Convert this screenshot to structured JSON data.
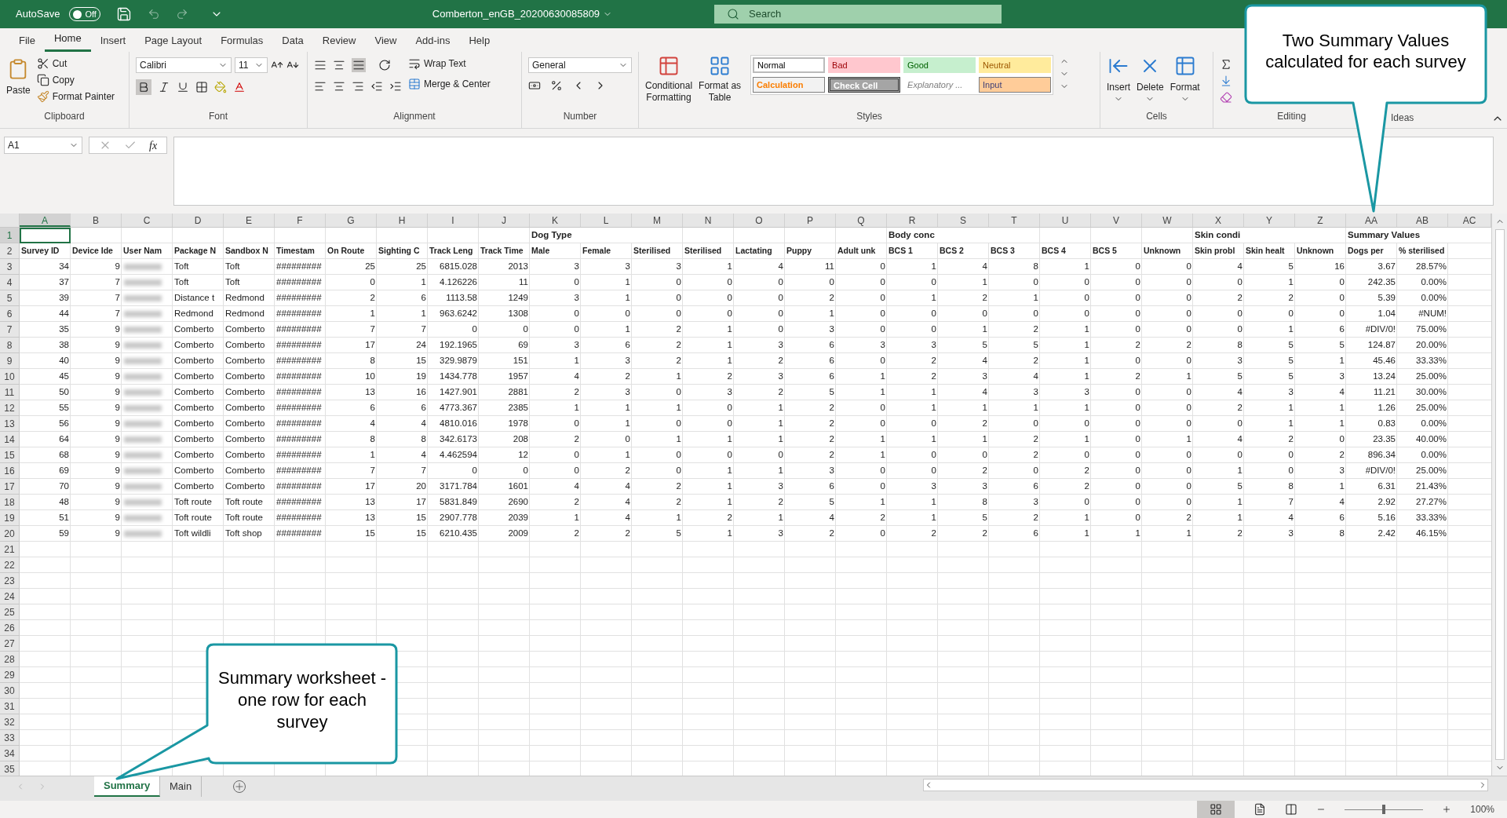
{
  "title_bar": {
    "autosave_label": "AutoSave",
    "autosave_on": false,
    "autosave_state": "Off",
    "filename": "Comberton_enGB_20200630085809",
    "search_placeholder": "Search"
  },
  "menu_tabs": [
    {
      "label": "File",
      "selected": false
    },
    {
      "label": "Home",
      "selected": true
    },
    {
      "label": "Insert",
      "selected": false
    },
    {
      "label": "Page Layout",
      "selected": false
    },
    {
      "label": "Formulas",
      "selected": false
    },
    {
      "label": "Data",
      "selected": false
    },
    {
      "label": "Review",
      "selected": false
    },
    {
      "label": "View",
      "selected": false
    },
    {
      "label": "Add-ins",
      "selected": false
    },
    {
      "label": "Help",
      "selected": false
    }
  ],
  "ribbon": {
    "clipboard": {
      "label": "Clipboard",
      "paste": "Paste",
      "cut": "Cut",
      "copy": "Copy",
      "format_painter": "Format Painter"
    },
    "font": {
      "label": "Font",
      "font_name": "Calibri",
      "font_size": "11"
    },
    "alignment": {
      "label": "Alignment",
      "wrap_text": "Wrap Text",
      "merge_center": "Merge & Center"
    },
    "number": {
      "label": "Number",
      "format": "General"
    },
    "styles": {
      "label": "Styles",
      "conditional_formatting": [
        "Conditional",
        "Formatting"
      ],
      "format_as_table": [
        "Format as",
        "Table"
      ],
      "gallery": [
        {
          "label": "Normal",
          "kind": "normal"
        },
        {
          "label": "Bad",
          "kind": "bad"
        },
        {
          "label": "Good",
          "kind": "good"
        },
        {
          "label": "Neutral",
          "kind": "neutral"
        },
        {
          "label": "Calculation",
          "kind": "calculation"
        },
        {
          "label": "Check Cell",
          "kind": "check"
        },
        {
          "label": "Explanatory ...",
          "kind": "explanatory"
        },
        {
          "label": "Input",
          "kind": "input"
        }
      ]
    },
    "cells": {
      "label": "Cells",
      "buttons": [
        "Insert",
        "Delete",
        "Format"
      ]
    },
    "editing": {
      "label": "Editing"
    },
    "ideas": {
      "label": "Ideas"
    }
  },
  "formula_bar": {
    "name_box": "A1",
    "function_label": "fx"
  },
  "columns": [
    {
      "letter": "A",
      "kind": "number"
    },
    {
      "letter": "B",
      "kind": "number"
    },
    {
      "letter": "C",
      "kind": "text"
    },
    {
      "letter": "D",
      "kind": "text"
    },
    {
      "letter": "E",
      "kind": "text"
    },
    {
      "letter": "F",
      "kind": "text"
    },
    {
      "letter": "G",
      "kind": "number"
    },
    {
      "letter": "H",
      "kind": "number"
    },
    {
      "letter": "I",
      "kind": "number"
    },
    {
      "letter": "J",
      "kind": "number"
    },
    {
      "letter": "K",
      "kind": "number"
    },
    {
      "letter": "L",
      "kind": "number"
    },
    {
      "letter": "M",
      "kind": "number"
    },
    {
      "letter": "N",
      "kind": "number"
    },
    {
      "letter": "O",
      "kind": "number"
    },
    {
      "letter": "P",
      "kind": "number"
    },
    {
      "letter": "Q",
      "kind": "number"
    },
    {
      "letter": "R",
      "kind": "number"
    },
    {
      "letter": "S",
      "kind": "number"
    },
    {
      "letter": "T",
      "kind": "number"
    },
    {
      "letter": "U",
      "kind": "number"
    },
    {
      "letter": "V",
      "kind": "number"
    },
    {
      "letter": "W",
      "kind": "number"
    },
    {
      "letter": "X",
      "kind": "number"
    },
    {
      "letter": "Y",
      "kind": "number"
    },
    {
      "letter": "Z",
      "kind": "number"
    },
    {
      "letter": "AA",
      "kind": "number"
    },
    {
      "letter": "AB",
      "kind": "number"
    },
    {
      "letter": "AC",
      "kind": "number"
    }
  ],
  "rows": [
    {
      "number": "1",
      "redacted": false,
      "header": true,
      "cells": [
        {
          "selected": true
        },
        null,
        null,
        null,
        null,
        null,
        null,
        null,
        null,
        null,
        "Dog Type",
        null,
        null,
        null,
        null,
        null,
        null,
        "Body conc",
        null,
        null,
        null,
        null,
        null,
        "Skin condi",
        null,
        null,
        "Summary Values",
        null,
        null
      ]
    },
    {
      "number": "2",
      "redacted": false,
      "header": true,
      "cells": [
        "Survey ID",
        "Device Ide",
        "User Nam",
        "Package N",
        "Sandbox N",
        "Timestam",
        "On Route",
        "Sighting C",
        "Track Leng",
        "Track Time",
        "Male",
        "Female",
        "Sterilised",
        "Sterilised",
        "Lactating",
        "Puppy",
        "Adult unk",
        "BCS 1",
        "BCS 2",
        "BCS 3",
        "BCS 4",
        "BCS 5",
        "Unknown",
        "Skin probl",
        "Skin healt",
        "Unknown",
        "Dogs per",
        "% sterilised",
        null
      ]
    },
    {
      "number": "3",
      "redacted": true,
      "header": false,
      "cells": [
        "34",
        "9",
        null,
        "Toft",
        "Toft",
        "#########",
        "25",
        "25",
        "6815.028",
        "2013",
        "3",
        "3",
        "3",
        "1",
        "4",
        "11",
        "0",
        "1",
        "4",
        "8",
        "1",
        "0",
        "0",
        "4",
        "5",
        "16",
        "3.67",
        "28.57%",
        null
      ]
    },
    {
      "number": "4",
      "redacted": true,
      "header": false,
      "cells": [
        "37",
        "7",
        null,
        "Toft",
        "Toft",
        "#########",
        "0",
        "1",
        "4.126226",
        "11",
        "0",
        "1",
        "0",
        "0",
        "0",
        "0",
        "0",
        "0",
        "1",
        "0",
        "0",
        "0",
        "0",
        "0",
        "1",
        "0",
        "242.35",
        "0.00%",
        null
      ]
    },
    {
      "number": "5",
      "redacted": true,
      "header": false,
      "cells": [
        "39",
        "7",
        null,
        "Distance t",
        "Redmond",
        "#########",
        "2",
        "6",
        "1113.58",
        "1249",
        "3",
        "1",
        "0",
        "0",
        "0",
        "2",
        "0",
        "1",
        "2",
        "1",
        "0",
        "0",
        "0",
        "2",
        "2",
        "0",
        "5.39",
        "0.00%",
        null
      ]
    },
    {
      "number": "6",
      "redacted": true,
      "header": false,
      "cells": [
        "44",
        "7",
        null,
        "Redmond",
        "Redmond",
        "#########",
        "1",
        "1",
        "963.6242",
        "1308",
        "0",
        "0",
        "0",
        "0",
        "0",
        "1",
        "0",
        "0",
        "0",
        "0",
        "0",
        "0",
        "0",
        "0",
        "0",
        "0",
        "1.04",
        "#NUM!",
        null
      ]
    },
    {
      "number": "7",
      "redacted": true,
      "header": false,
      "cells": [
        "35",
        "9",
        null,
        "Comberto",
        "Comberto",
        "#########",
        "7",
        "7",
        "0",
        "0",
        "0",
        "1",
        "2",
        "1",
        "0",
        "3",
        "0",
        "0",
        "1",
        "2",
        "1",
        "0",
        "0",
        "0",
        "1",
        "6",
        "#DIV/0!",
        "75.00%",
        null
      ]
    },
    {
      "number": "8",
      "redacted": true,
      "header": false,
      "cells": [
        "38",
        "9",
        null,
        "Comberto",
        "Comberto",
        "#########",
        "17",
        "24",
        "192.1965",
        "69",
        "3",
        "6",
        "2",
        "1",
        "3",
        "6",
        "3",
        "3",
        "5",
        "5",
        "1",
        "2",
        "2",
        "8",
        "5",
        "5",
        "124.87",
        "20.00%",
        null
      ]
    },
    {
      "number": "9",
      "redacted": true,
      "header": false,
      "cells": [
        "40",
        "9",
        null,
        "Comberto",
        "Comberto",
        "#########",
        "8",
        "15",
        "329.9879",
        "151",
        "1",
        "3",
        "2",
        "1",
        "2",
        "6",
        "0",
        "2",
        "4",
        "2",
        "1",
        "0",
        "0",
        "3",
        "5",
        "1",
        "45.46",
        "33.33%",
        null
      ]
    },
    {
      "number": "10",
      "redacted": true,
      "header": false,
      "cells": [
        "45",
        "9",
        null,
        "Comberto",
        "Comberto",
        "#########",
        "10",
        "19",
        "1434.778",
        "1957",
        "4",
        "2",
        "1",
        "2",
        "3",
        "6",
        "1",
        "2",
        "3",
        "4",
        "1",
        "2",
        "1",
        "5",
        "5",
        "3",
        "13.24",
        "25.00%",
        null
      ]
    },
    {
      "number": "11",
      "redacted": true,
      "header": false,
      "cells": [
        "50",
        "9",
        null,
        "Comberto",
        "Comberto",
        "#########",
        "13",
        "16",
        "1427.901",
        "2881",
        "2",
        "3",
        "0",
        "3",
        "2",
        "5",
        "1",
        "1",
        "4",
        "3",
        "3",
        "0",
        "0",
        "4",
        "3",
        "4",
        "11.21",
        "30.00%",
        null
      ]
    },
    {
      "number": "12",
      "redacted": true,
      "header": false,
      "cells": [
        "55",
        "9",
        null,
        "Comberto",
        "Comberto",
        "#########",
        "6",
        "6",
        "4773.367",
        "2385",
        "1",
        "1",
        "1",
        "0",
        "1",
        "2",
        "0",
        "1",
        "1",
        "1",
        "1",
        "0",
        "0",
        "2",
        "1",
        "1",
        "1.26",
        "25.00%",
        null
      ]
    },
    {
      "number": "13",
      "redacted": true,
      "header": false,
      "cells": [
        "56",
        "9",
        null,
        "Comberto",
        "Comberto",
        "#########",
        "4",
        "4",
        "4810.016",
        "1978",
        "0",
        "1",
        "0",
        "0",
        "1",
        "2",
        "0",
        "0",
        "2",
        "0",
        "0",
        "0",
        "0",
        "0",
        "1",
        "1",
        "0.83",
        "0.00%",
        null
      ]
    },
    {
      "number": "14",
      "redacted": true,
      "header": false,
      "cells": [
        "64",
        "9",
        null,
        "Comberto",
        "Comberto",
        "#########",
        "8",
        "8",
        "342.6173",
        "208",
        "2",
        "0",
        "1",
        "1",
        "1",
        "2",
        "1",
        "1",
        "1",
        "2",
        "1",
        "0",
        "1",
        "4",
        "2",
        "0",
        "23.35",
        "40.00%",
        null
      ]
    },
    {
      "number": "15",
      "redacted": true,
      "header": false,
      "cells": [
        "68",
        "9",
        null,
        "Comberto",
        "Comberto",
        "#########",
        "1",
        "4",
        "4.462594",
        "12",
        "0",
        "1",
        "0",
        "0",
        "0",
        "2",
        "1",
        "0",
        "0",
        "2",
        "0",
        "0",
        "0",
        "0",
        "0",
        "2",
        "896.34",
        "0.00%",
        null
      ]
    },
    {
      "number": "16",
      "redacted": true,
      "header": false,
      "cells": [
        "69",
        "9",
        null,
        "Comberto",
        "Comberto",
        "#########",
        "7",
        "7",
        "0",
        "0",
        "0",
        "2",
        "0",
        "1",
        "1",
        "3",
        "0",
        "0",
        "2",
        "0",
        "2",
        "0",
        "0",
        "1",
        "0",
        "3",
        "#DIV/0!",
        "25.00%",
        null
      ]
    },
    {
      "number": "17",
      "redacted": true,
      "header": false,
      "cells": [
        "70",
        "9",
        null,
        "Comberto",
        "Comberto",
        "#########",
        "17",
        "20",
        "3171.784",
        "1601",
        "4",
        "4",
        "2",
        "1",
        "3",
        "6",
        "0",
        "3",
        "3",
        "6",
        "2",
        "0",
        "0",
        "5",
        "8",
        "1",
        "6.31",
        "21.43%",
        null
      ]
    },
    {
      "number": "18",
      "redacted": true,
      "header": false,
      "cells": [
        "48",
        "9",
        null,
        "Toft route",
        "Toft route",
        "#########",
        "13",
        "17",
        "5831.849",
        "2690",
        "2",
        "4",
        "2",
        "1",
        "2",
        "5",
        "1",
        "1",
        "8",
        "3",
        "0",
        "0",
        "0",
        "1",
        "7",
        "4",
        "2.92",
        "27.27%",
        null
      ]
    },
    {
      "number": "19",
      "redacted": true,
      "header": false,
      "cells": [
        "51",
        "9",
        null,
        "Toft route",
        "Toft route",
        "#########",
        "13",
        "15",
        "2907.778",
        "2039",
        "1",
        "4",
        "1",
        "2",
        "1",
        "4",
        "2",
        "1",
        "5",
        "2",
        "1",
        "0",
        "2",
        "1",
        "4",
        "6",
        "5.16",
        "33.33%",
        null
      ]
    },
    {
      "number": "20",
      "redacted": true,
      "header": false,
      "cells": [
        "59",
        "9",
        null,
        "Toft wildli",
        "Toft shop",
        "#########",
        "15",
        "15",
        "6210.435",
        "2009",
        "2",
        "2",
        "5",
        "1",
        "3",
        "2",
        "0",
        "2",
        "2",
        "6",
        "1",
        "1",
        "1",
        "2",
        "3",
        "8",
        "2.42",
        "46.15%",
        null
      ]
    }
  ],
  "empty_rows": [
    "21",
    "22",
    "23",
    "24",
    "25",
    "26",
    "27",
    "28",
    "29",
    "30",
    "31",
    "32",
    "33",
    "34",
    "35"
  ],
  "sheet_tabs": [
    {
      "label": "Summary",
      "selected": true
    },
    {
      "label": "Main",
      "selected": false
    }
  ],
  "status_bar": {
    "zoom": "100%",
    "zoom_slider": {
      "level": 0.5
    }
  },
  "callouts": [
    {
      "text": "Two Summary Values calculated for each survey"
    },
    {
      "text": "Summary worksheet - one row for each survey"
    }
  ]
}
